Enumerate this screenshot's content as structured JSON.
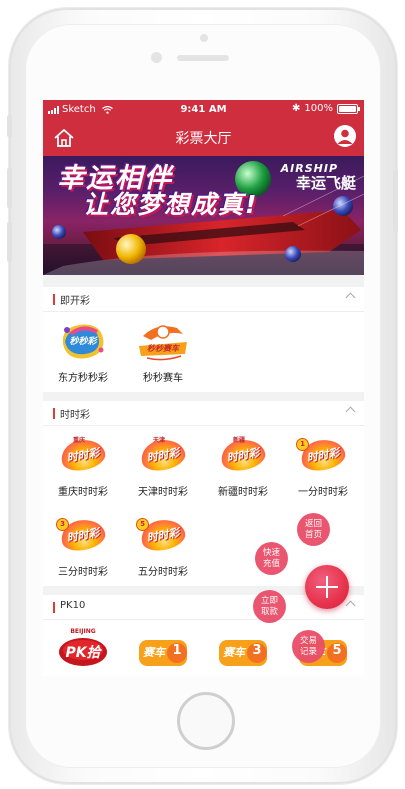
{
  "status_bar": {
    "carrier": "Sketch",
    "time": "9:41 AM",
    "battery": "100%"
  },
  "nav": {
    "title": "彩票大厅"
  },
  "banner": {
    "headline_1": "幸运相伴",
    "headline_2": "让您梦想成真!",
    "brand": "AIRSHIP",
    "product": "幸运飞艇"
  },
  "sections": [
    {
      "label": "即开彩",
      "games": [
        {
          "name": "东方秒秒彩",
          "logo_text": "秒秒彩"
        },
        {
          "name": "秒秒赛车",
          "logo_text": "秒秒赛车"
        }
      ]
    },
    {
      "label": "时时彩",
      "games": [
        {
          "name": "重庆时时彩",
          "logo_text": "时时彩",
          "logo_top": "重庆"
        },
        {
          "name": "天津时时彩",
          "logo_text": "时时彩",
          "logo_top": "天津"
        },
        {
          "name": "新疆时时彩",
          "logo_text": "时时彩",
          "logo_top": "新疆"
        },
        {
          "name": "一分时时彩",
          "logo_text": "时时彩",
          "logo_badge": "1"
        },
        {
          "name": "三分时时彩",
          "logo_text": "时时彩",
          "logo_badge": "3"
        },
        {
          "name": "五分时时彩",
          "logo_text": "时时彩",
          "logo_badge": "5"
        }
      ]
    },
    {
      "label": "PK10",
      "games": [
        {
          "name": "北京PK拾",
          "logo_text": "PK拾",
          "logo_top": "BEIJING"
        },
        {
          "name": "赛车1",
          "logo_text": "赛车",
          "logo_badge": "1"
        },
        {
          "name": "赛车3",
          "logo_text": "赛车",
          "logo_badge": "3"
        },
        {
          "name": "赛车5",
          "logo_text": "赛车",
          "logo_badge": "5"
        }
      ]
    }
  ],
  "fab_menu": {
    "back_home": [
      "返回",
      "首页"
    ],
    "quick_recharge": [
      "快速",
      "充值"
    ],
    "withdraw": [
      "立即",
      "取款"
    ],
    "records": [
      "交易",
      "记录"
    ]
  },
  "colors": {
    "primary": "#cf2e3f",
    "fab": "#e8364f",
    "accent_bar": "#e53935"
  }
}
